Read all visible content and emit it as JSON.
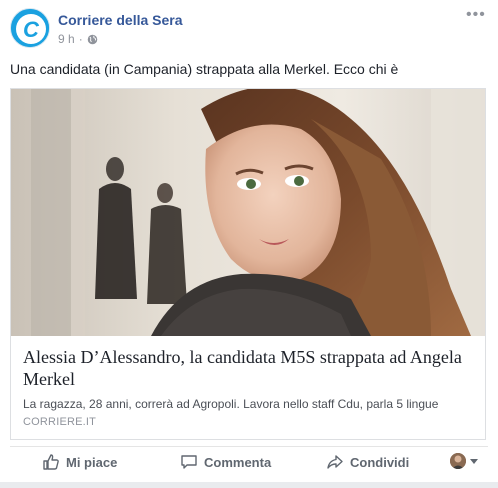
{
  "post": {
    "page_name": "Corriere della Sera",
    "time": "9 h",
    "separator": "·",
    "text": "Una candidata (in Campania) strappata alla Merkel. Ecco chi è",
    "more_icon": "more-horizontal-icon",
    "privacy_icon": "globe-icon"
  },
  "link": {
    "title": "Alessia D’Alessandro, la candidata M5S strappata ad Angela Merkel",
    "description": "La ragazza, 28 anni, correrà ad Agropoli. Lavora nello staff Cdu, parla 5 lingue",
    "domain": "CORRIERE.IT"
  },
  "actions": {
    "like": "Mi piace",
    "comment": "Commenta",
    "share": "Condividi"
  },
  "colors": {
    "page_name": "#365899",
    "brand_logo": "#1aa1e0",
    "action_text": "#606770",
    "meta": "#90949c"
  }
}
